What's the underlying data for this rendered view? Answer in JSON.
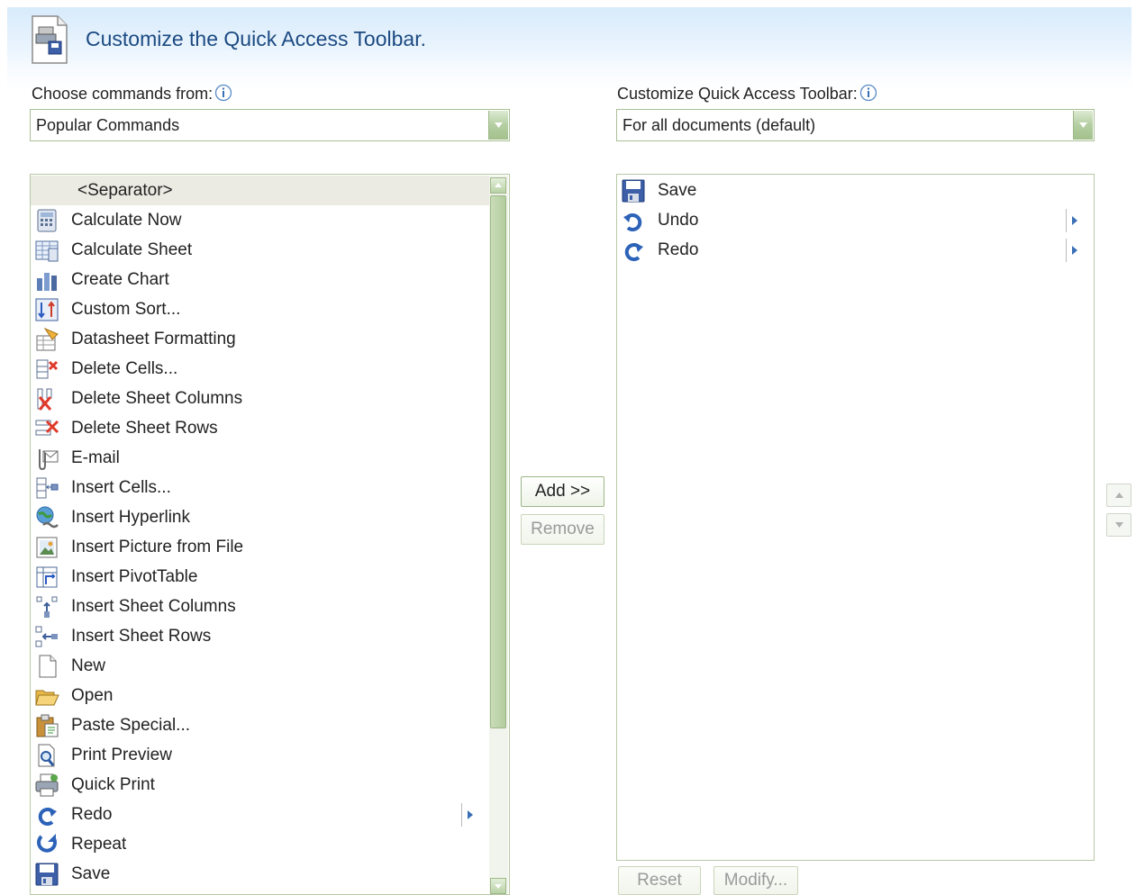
{
  "header": {
    "title": "Customize the Quick Access Toolbar."
  },
  "left": {
    "label": "Choose commands from:",
    "dropdown_value": "Popular Commands",
    "commands": [
      {
        "label": "<Separator>",
        "icon": "none",
        "selected": true
      },
      {
        "label": "Calculate Now",
        "icon": "calculator-icon"
      },
      {
        "label": "Calculate Sheet",
        "icon": "calculate-sheet-icon"
      },
      {
        "label": "Create Chart",
        "icon": "chart-icon"
      },
      {
        "label": "Custom Sort...",
        "icon": "sort-icon"
      },
      {
        "label": "Datasheet Formatting",
        "icon": "datasheet-format-icon"
      },
      {
        "label": "Delete Cells...",
        "icon": "delete-cells-icon"
      },
      {
        "label": "Delete Sheet Columns",
        "icon": "delete-columns-icon"
      },
      {
        "label": "Delete Sheet Rows",
        "icon": "delete-rows-icon"
      },
      {
        "label": "E-mail",
        "icon": "email-icon"
      },
      {
        "label": "Insert Cells...",
        "icon": "insert-cells-icon"
      },
      {
        "label": "Insert Hyperlink",
        "icon": "hyperlink-icon"
      },
      {
        "label": "Insert Picture from File",
        "icon": "picture-icon"
      },
      {
        "label": "Insert PivotTable",
        "icon": "pivottable-icon"
      },
      {
        "label": "Insert Sheet Columns",
        "icon": "insert-columns-icon"
      },
      {
        "label": "Insert Sheet Rows",
        "icon": "insert-rows-icon"
      },
      {
        "label": "New",
        "icon": "new-document-icon"
      },
      {
        "label": "Open",
        "icon": "open-folder-icon"
      },
      {
        "label": "Paste Special...",
        "icon": "paste-icon"
      },
      {
        "label": "Print Preview",
        "icon": "print-preview-icon"
      },
      {
        "label": "Quick Print",
        "icon": "printer-icon"
      },
      {
        "label": "Redo",
        "icon": "redo-icon",
        "submenu": true
      },
      {
        "label": "Repeat",
        "icon": "repeat-icon"
      },
      {
        "label": "Save",
        "icon": "save-icon"
      }
    ]
  },
  "right": {
    "label": "Customize Quick Access Toolbar:",
    "dropdown_value": "For all documents (default)",
    "items": [
      {
        "label": "Save",
        "icon": "save-icon"
      },
      {
        "label": "Undo",
        "icon": "undo-icon",
        "submenu": true
      },
      {
        "label": "Redo",
        "icon": "redo-icon",
        "submenu": true
      }
    ]
  },
  "buttons": {
    "add": "Add >>",
    "remove": "Remove",
    "reset": "Reset",
    "modify": "Modify..."
  },
  "colors": {
    "title": "#1c4a82",
    "border": "#aabf96",
    "accent": "#b4cea1"
  }
}
